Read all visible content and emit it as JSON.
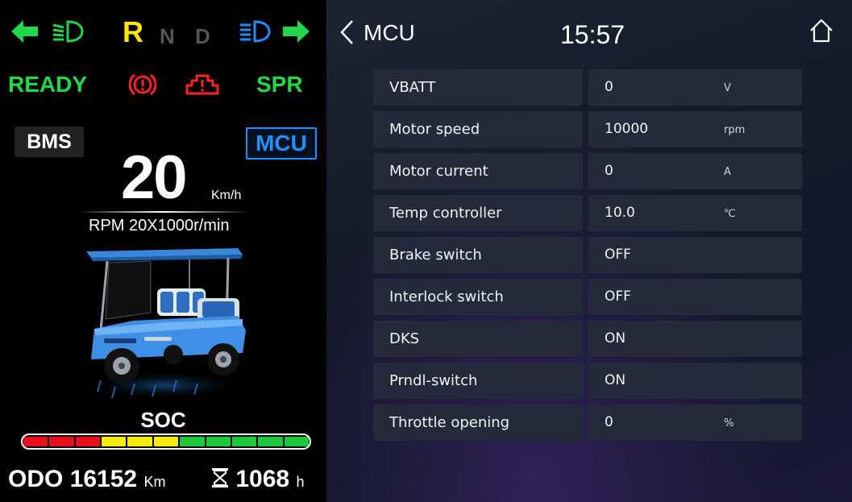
{
  "colors": {
    "accent_green": "#1fd94a",
    "accent_yellow": "#ffe600",
    "accent_red": "#ff2222",
    "accent_blue": "#1e90ff",
    "gear_inactive": "#555555"
  },
  "indicators": [
    {
      "icon": "left-turn-arrow-icon",
      "color": "#1fd94a"
    },
    {
      "icon": "low-beam-icon",
      "color": "#1fd94a"
    },
    {
      "icon": "high-beam-icon",
      "color": "#1e90ff"
    },
    {
      "icon": "right-turn-arrow-icon",
      "color": "#1fd94a"
    }
  ],
  "gears": [
    {
      "label": "R",
      "active": true
    },
    {
      "label": "N",
      "active": false
    },
    {
      "label": "D",
      "active": false
    }
  ],
  "status": {
    "ready": "READY",
    "spr": "SPR",
    "brake_icon": "parking-brake-warning-icon",
    "fault_icon": "motor-fault-warning-icon"
  },
  "cluster": {
    "bms_button": "BMS",
    "mcu_button": "MCU",
    "speed": "20",
    "speed_unit": "Km/h",
    "rpm": "RPM 20X1000r/min",
    "soc_label": "SOC",
    "soc_segments": [
      "red",
      "red",
      "red",
      "yellow",
      "yellow",
      "yellow",
      "green",
      "green",
      "green",
      "green",
      "green"
    ],
    "odo_label": "ODO",
    "odo_value": "16152",
    "odo_unit": "Km",
    "hours_value": "1068",
    "hours_unit": "h"
  },
  "header": {
    "title": "MCU",
    "time": "15:57"
  },
  "rows": [
    {
      "label": "VBATT",
      "value": "0",
      "unit": "V"
    },
    {
      "label": "Motor speed",
      "value": "10000",
      "unit": "rpm"
    },
    {
      "label": "Motor current",
      "value": "0",
      "unit": "A"
    },
    {
      "label": "Temp controller",
      "value": "10.0",
      "unit": "℃"
    },
    {
      "label": "Brake switch",
      "value": "OFF",
      "unit": ""
    },
    {
      "label": "Interlock switch",
      "value": "OFF",
      "unit": ""
    },
    {
      "label": "DKS",
      "value": "ON",
      "unit": ""
    },
    {
      "label": "Prndl-switch",
      "value": "ON",
      "unit": ""
    },
    {
      "label": "Throttle opening",
      "value": "0",
      "unit": "%"
    }
  ]
}
